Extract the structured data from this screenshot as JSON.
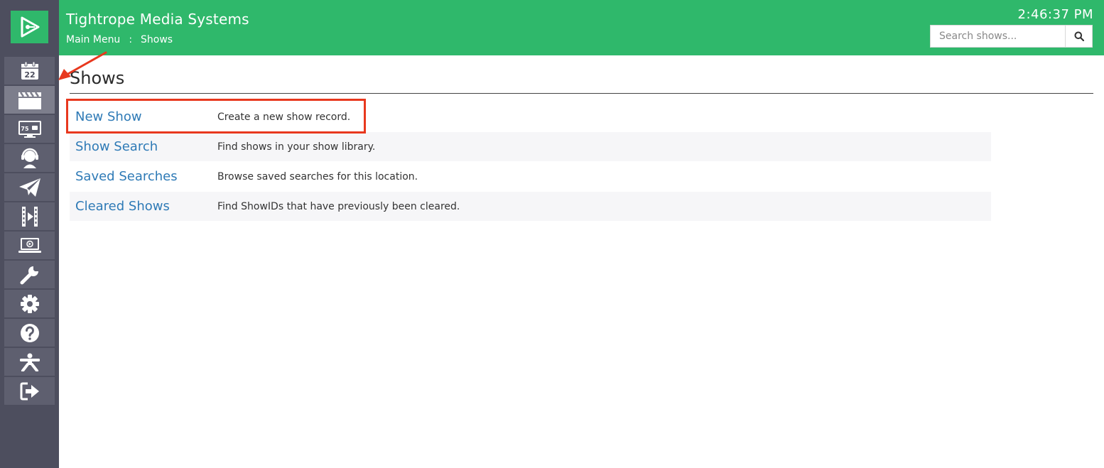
{
  "app": {
    "title": "Tightrope Media Systems",
    "clock": "2:46:37 PM"
  },
  "breadcrumb": {
    "items": [
      "Main Menu",
      "Shows"
    ],
    "separator": ":"
  },
  "search": {
    "placeholder": "Search shows...",
    "value": ""
  },
  "sidebar": {
    "calendar_day": "22",
    "display_badge": "75",
    "items": [
      {
        "icon": "calendar-icon"
      },
      {
        "icon": "clapperboard-icon",
        "active": true
      },
      {
        "icon": "display-icon"
      },
      {
        "icon": "headset-user-icon"
      },
      {
        "icon": "paper-plane-icon"
      },
      {
        "icon": "film-play-icon"
      },
      {
        "icon": "laptop-play-icon"
      },
      {
        "icon": "wrench-icon"
      },
      {
        "icon": "gear-icon"
      },
      {
        "icon": "help-icon"
      },
      {
        "icon": "person-icon"
      },
      {
        "icon": "sign-out-icon"
      }
    ]
  },
  "main": {
    "title": "Shows",
    "menu": [
      {
        "label": "New Show",
        "description": "Create a new show record."
      },
      {
        "label": "Show Search",
        "description": "Find shows in your show library."
      },
      {
        "label": "Saved Searches",
        "description": "Browse saved searches for this location."
      },
      {
        "label": "Cleared Shows",
        "description": "Find ShowIDs that have previously been cleared."
      }
    ]
  },
  "colors": {
    "header_green": "#2fb86b",
    "sidebar_dark": "#4d4e5e",
    "link_blue": "#2e7ab6",
    "annotation_red": "#e8381e"
  }
}
